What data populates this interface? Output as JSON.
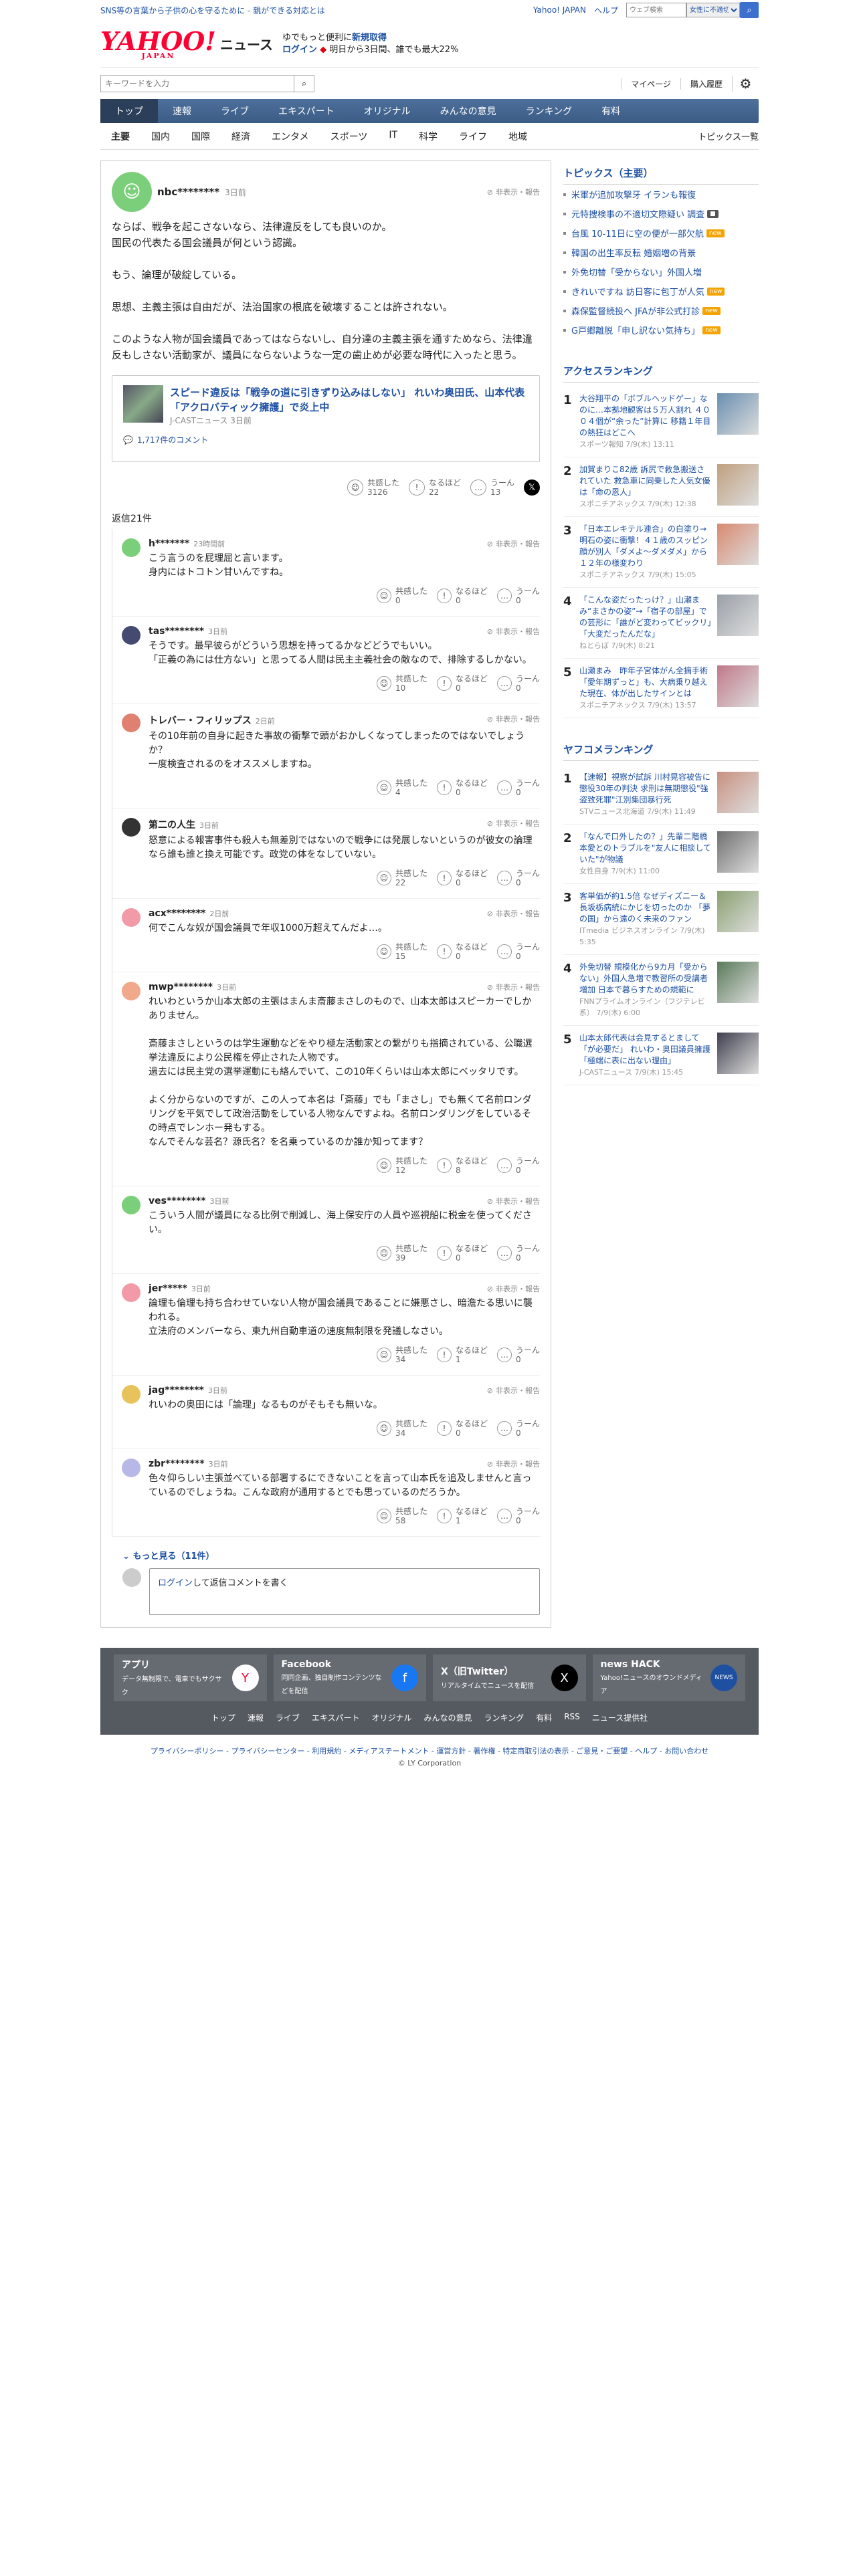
{
  "topbar": {
    "notice": "SNS等の言葉から子供の心を守るために - 親ができる対応とは",
    "links": [
      "Yahoo! JAPAN",
      "ヘルプ"
    ],
    "search_placeholder": "ウェブ検索",
    "search_select": "女性に不適切…"
  },
  "header": {
    "logo": "YAHOO!",
    "logo_sub": "JAPAN",
    "title": "ニュース",
    "promo_line1": "ゆでもっと便利に",
    "promo_new": "新規取得",
    "promo_login": "ログイン",
    "promo_line2": "明日から3日間、誰でも最大22%"
  },
  "search": {
    "placeholder": "キーワードを入力",
    "mypage": "マイページ",
    "history": "購入履歴"
  },
  "nav": [
    "トップ",
    "速報",
    "ライブ",
    "エキスパート",
    "オリジナル",
    "みんなの意見",
    "ランキング",
    "有料"
  ],
  "subnav": [
    "主要",
    "国内",
    "国際",
    "経済",
    "エンタメ",
    "スポーツ",
    "IT",
    "科学",
    "ライフ",
    "地域"
  ],
  "subnav_right": "トピックス一覧",
  "comment": {
    "user": "nbc********",
    "time": "3日前",
    "report": "非表示・報告",
    "paragraphs": [
      "ならば、戦争を起こさないなら、法律違反をしても良いのか。\n国民の代表たる国会議員が何という認識。",
      "もう、論理が破綻している。",
      "思想、主義主張は自由だが、法治国家の根底を破壊することは許されない。",
      "このような人物が国会議員であってはならないし、自分達の主義主張を通すためなら、法律違反もしさない活動家が、議員にならないような一定の歯止めが必要な時代に入ったと思う。"
    ],
    "article": {
      "title": "スピード違反は「戦争の道に引きずり込みはしない」 れいわ奥田氏、山本代表「アクロバティック擁護」で炎上中",
      "source": "J-CASTニュース 3日前",
      "comments": "1,717件のコメント"
    },
    "reactions": [
      {
        "label": "共感した",
        "count": "3126"
      },
      {
        "label": "なるほど",
        "count": "22"
      },
      {
        "label": "うーん",
        "count": "13"
      }
    ]
  },
  "replies_count": "返信21件",
  "replies": [
    {
      "name": "h*******",
      "time": "23時間前",
      "text": "こう言うのを屁理屈と言います。\n身内にはトコトン甘いんですね。",
      "r": [
        "0",
        "0",
        "0"
      ],
      "color": "#7bcf7b"
    },
    {
      "name": "tas********",
      "time": "3日前",
      "text": "そうです。最早彼らがどういう思想を持ってるかなどどうでもいい。\n「正義の為には仕方ない」と思ってる人間は民主主義社会の敵なので、排除するしかない。",
      "r": [
        "10",
        "0",
        "0"
      ],
      "color": "#444a70"
    },
    {
      "name": "トレバー・フィリップス",
      "time": "2日前",
      "text": "その10年前の自身に起きた事故の衝撃で頭がおかしくなってしまったのではないでしょうか？\n一度検査されるのをオススメしますね。",
      "r": [
        "4",
        "0",
        "0"
      ],
      "color": "#e08070"
    },
    {
      "name": "第二の人生",
      "time": "3日前",
      "text": "怒意による報害事件も殺人も無差別ではないので戦争には発展しないというのが彼女の論理なら誰も誰と換え可能です。政党の体をなしていない。",
      "r": [
        "22",
        "0",
        "0"
      ],
      "color": "#333"
    },
    {
      "name": "acx********",
      "time": "2日前",
      "text": "何でこんな奴が国会議員で年収1000万超えてんだよ…。",
      "r": [
        "15",
        "0",
        "0"
      ],
      "color": "#f29aa6"
    },
    {
      "name": "mwp********",
      "time": "3日前",
      "text": "れいわというか山本太郎の主張はまんま斎藤まさしのもので、山本太郎はスピーカーでしかありません。\n\n斎藤まさしというのは学生運動などをやり極左活動家との繋がりも指摘されている、公職選挙法違反により公民権を停止された人物です。\n過去には民主党の選挙運動にも絡んでいて、この10年くらいは山本太郎にベッタリです。\n\nよく分からないのですが、この人って本名は「斎藤」でも「まさし」でも無くて名前ロンダリングを平気でして政治活動をしている人物なんですよね。名前ロンダリングをしているその時点でレンホー発もする。\nなんでそんな芸名？源氏名？を名乗っているのか誰か知ってます？",
      "r": [
        "12",
        "8",
        "0"
      ],
      "color": "#f0a98a"
    },
    {
      "name": "ves********",
      "time": "3日前",
      "text": "こういう人間が議員になる比例で削減し、海上保安庁の人員や巡視船に税金を使ってください。",
      "r": [
        "39",
        "0",
        "0"
      ],
      "color": "#7bcf7b"
    },
    {
      "name": "jer*****",
      "time": "3日前",
      "text": "論理も倫理も持ち合わせていない人物が国会議員であることに嫌悪さし、暗澹たる思いに襲われる。\n立法府のメンバーなら、東九州自動車道の速度無制限を発議しなさい。",
      "r": [
        "34",
        "1",
        "0"
      ],
      "color": "#f29aa6"
    },
    {
      "name": "jag********",
      "time": "3日前",
      "text": "れいわの奥田には「論理」なるものがそもそも無いな。",
      "r": [
        "34",
        "0",
        "0"
      ],
      "color": "#e8c25a"
    },
    {
      "name": "zbr********",
      "time": "3日前",
      "text": "色々仰らしい主張並べている部署するにできないことを言って山本氏を追及しませんと言っているのでしょうね。こんな政府が通用するとでも思っているのだろうか。",
      "r": [
        "58",
        "1",
        "0"
      ],
      "color": "#b8b8e8"
    }
  ],
  "more_label": "もっと見る（11件）",
  "login_prompt_link": "ログイン",
  "login_prompt_rest": "して返信コメントを書く",
  "sidebar": {
    "topics_title": "トピックス（主要）",
    "topics": [
      {
        "text": "米軍が追加攻撃牙 イランも報復",
        "badge": ""
      },
      {
        "text": "元特捜検事の不適切文際疑い 調査",
        "badge": "■"
      },
      {
        "text": "台風 10-11日に空の便が一部欠航",
        "badge": "new"
      },
      {
        "text": "韓国の出生率反転 婚姻増の背景",
        "badge": ""
      },
      {
        "text": "外免切替「受からない」外国人増",
        "badge": ""
      },
      {
        "text": "きれいですね 訪日客に包丁が人気",
        "badge": "new"
      },
      {
        "text": "森保監督続投へ JFAが非公式打診",
        "badge": "new"
      },
      {
        "text": "G戸郷離脱「申し訳ない気持ち」",
        "badge": "new"
      }
    ],
    "access_title": "アクセスランキング",
    "access": [
      {
        "no": "1",
        "text": "大谷翔平の「ボブルヘッドゲー」なのに…本拠地観客は５万人割れ ４００４個が“余った”計算に 移籍１年目の熱狂はどこへ",
        "src": "スポーツ報知 7/9(木) 13:11",
        "color": "#6a8fb0"
      },
      {
        "no": "2",
        "text": "加賀まりこ82歳 訴尻で救急搬送されていた 救急車に同乗した人気女優は「命の恩人」",
        "src": "スポニチアネックス 7/9(木) 12:38",
        "color": "#c0a080"
      },
      {
        "no": "3",
        "text": "「日本エレキテル連合」の白塗り→明石の姿に衝撃！４１歳のスッピン顔が別人「ダメよ～ダメダメ」から１２年の様変わり",
        "src": "スポニチアネックス 7/9(木) 15:05",
        "color": "#d88a70"
      },
      {
        "no": "4",
        "text": "「こんな姿だったっけ？」山瀬まみ“まさかの姿”→「宿子の部屋」での芸形に「誰がど変わってビックリ」「大変だったんだな」",
        "src": "ねとらぼ 7/9(木) 8:21",
        "color": "#9aa0a8"
      },
      {
        "no": "5",
        "text": "山瀬まみ　昨年子宮体がん全摘手術「愛年期ずっと」も、大病乗り越えた現在、体が出したサインとは",
        "src": "スポニチアネックス 7/9(木) 13:57",
        "color": "#c07888"
      }
    ],
    "comment_title": "ヤフコメランキング",
    "comment_rank": [
      {
        "no": "1",
        "text": "【速報】視察が試訴 川村晃容被告に懲役30年の判決 求刑は無期懲役\"強盗致死罪\"江別集団暴行死",
        "src": "STVニュース北海道 7/9(木) 11:49",
        "color": "#c89080"
      },
      {
        "no": "2",
        "text": "「なんで口外したの？」先輩二階橋本愛とのトラブルを\"友人に相談していた\"が物議",
        "src": "女性自身 7/9(木) 11:00",
        "color": "#707070"
      },
      {
        "no": "3",
        "text": "客単価が約1.5倍 なぜディズニー＆長坂栃病統にかじを切ったのか 「夢の国」から遠のく未来のファン",
        "src": "ITmedia ビジネスオンライン 7/9(木) 5:35",
        "color": "#8aa070"
      },
      {
        "no": "4",
        "text": "外免切替 規模化から9カ月「受からない」外国人急増で教習所の受講者増加 日本で暮らすための規範に",
        "src": "FNNプライムオンライン（フジテレビ系） 7/9(木) 6:00",
        "color": "#5a7a5a"
      },
      {
        "no": "5",
        "text": "山本太郎代表は会見するとまして「が必要だ」 れいわ・奥田議員擁護 「極端に表に出ない理由」",
        "src": "J-CASTニュース 7/9(木) 15:45",
        "color": "#404050"
      }
    ]
  },
  "footer": {
    "apps": [
      {
        "title": "アプリ",
        "desc": "データ無制限で、電車でもサクサク",
        "icon": "Y"
      },
      {
        "title": "Facebook",
        "desc": "同同企画、独自制作コンテンツなどを配信",
        "icon": "f"
      },
      {
        "title": "X（旧Twitter）",
        "desc": "リアルタイムでニュースを配信",
        "icon": "X"
      },
      {
        "title": "news HACK",
        "desc": "Yahoo!ニュースのオウンドメディア",
        "icon": "NEWS"
      }
    ],
    "links": [
      "トップ",
      "速報",
      "ライブ",
      "エキスパート",
      "オリジナル",
      "みんなの意見",
      "ランキング",
      "有料",
      "RSS",
      "ニュース提供社"
    ],
    "bottom": "プライバシーポリシー - プライバシーセンター - 利用規約 - メディアステートメント - 運営方針 - 著作権 - 特定商取引法の表示 - ご意見・ご要望 - ヘルプ - お問い合わせ",
    "copyright": "© LY Corporation"
  }
}
